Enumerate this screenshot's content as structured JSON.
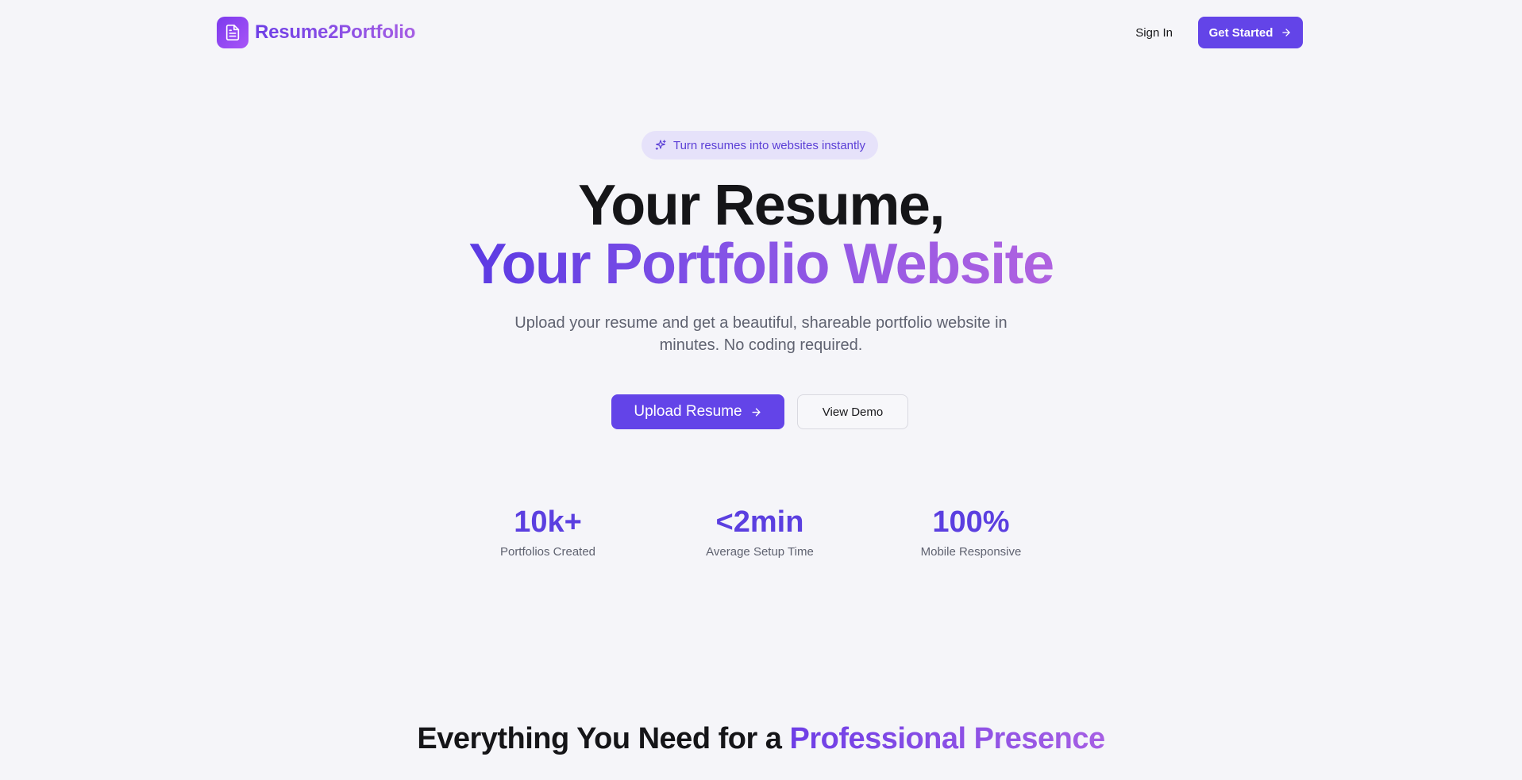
{
  "brand": {
    "name": "Resume2Portfolio",
    "icon": "document-icon"
  },
  "nav": {
    "sign_in": "Sign In",
    "get_started": "Get Started"
  },
  "hero": {
    "badge": "Turn resumes into websites instantly",
    "title_line1": "Your Resume,",
    "title_line2": "Your Portfolio Website",
    "subtitle": "Upload your resume and get a beautiful, shareable portfolio website in minutes. No coding required.",
    "primary_cta": "Upload Resume",
    "secondary_cta": "View Demo"
  },
  "stats": [
    {
      "value": "10k+",
      "label": "Portfolios Created"
    },
    {
      "value": "<2min",
      "label": "Average Setup Time"
    },
    {
      "value": "100%",
      "label": "Mobile Responsive"
    }
  ],
  "features": {
    "heading_prefix": "Everything You Need for a",
    "heading_accent": "Professional Presence"
  },
  "colors": {
    "primary": "#6344e8",
    "accent_gradient_start": "#5b3ae3",
    "accent_gradient_end": "#b062e0",
    "background": "#f5f5f9",
    "badge_bg": "#e6e2fa"
  }
}
